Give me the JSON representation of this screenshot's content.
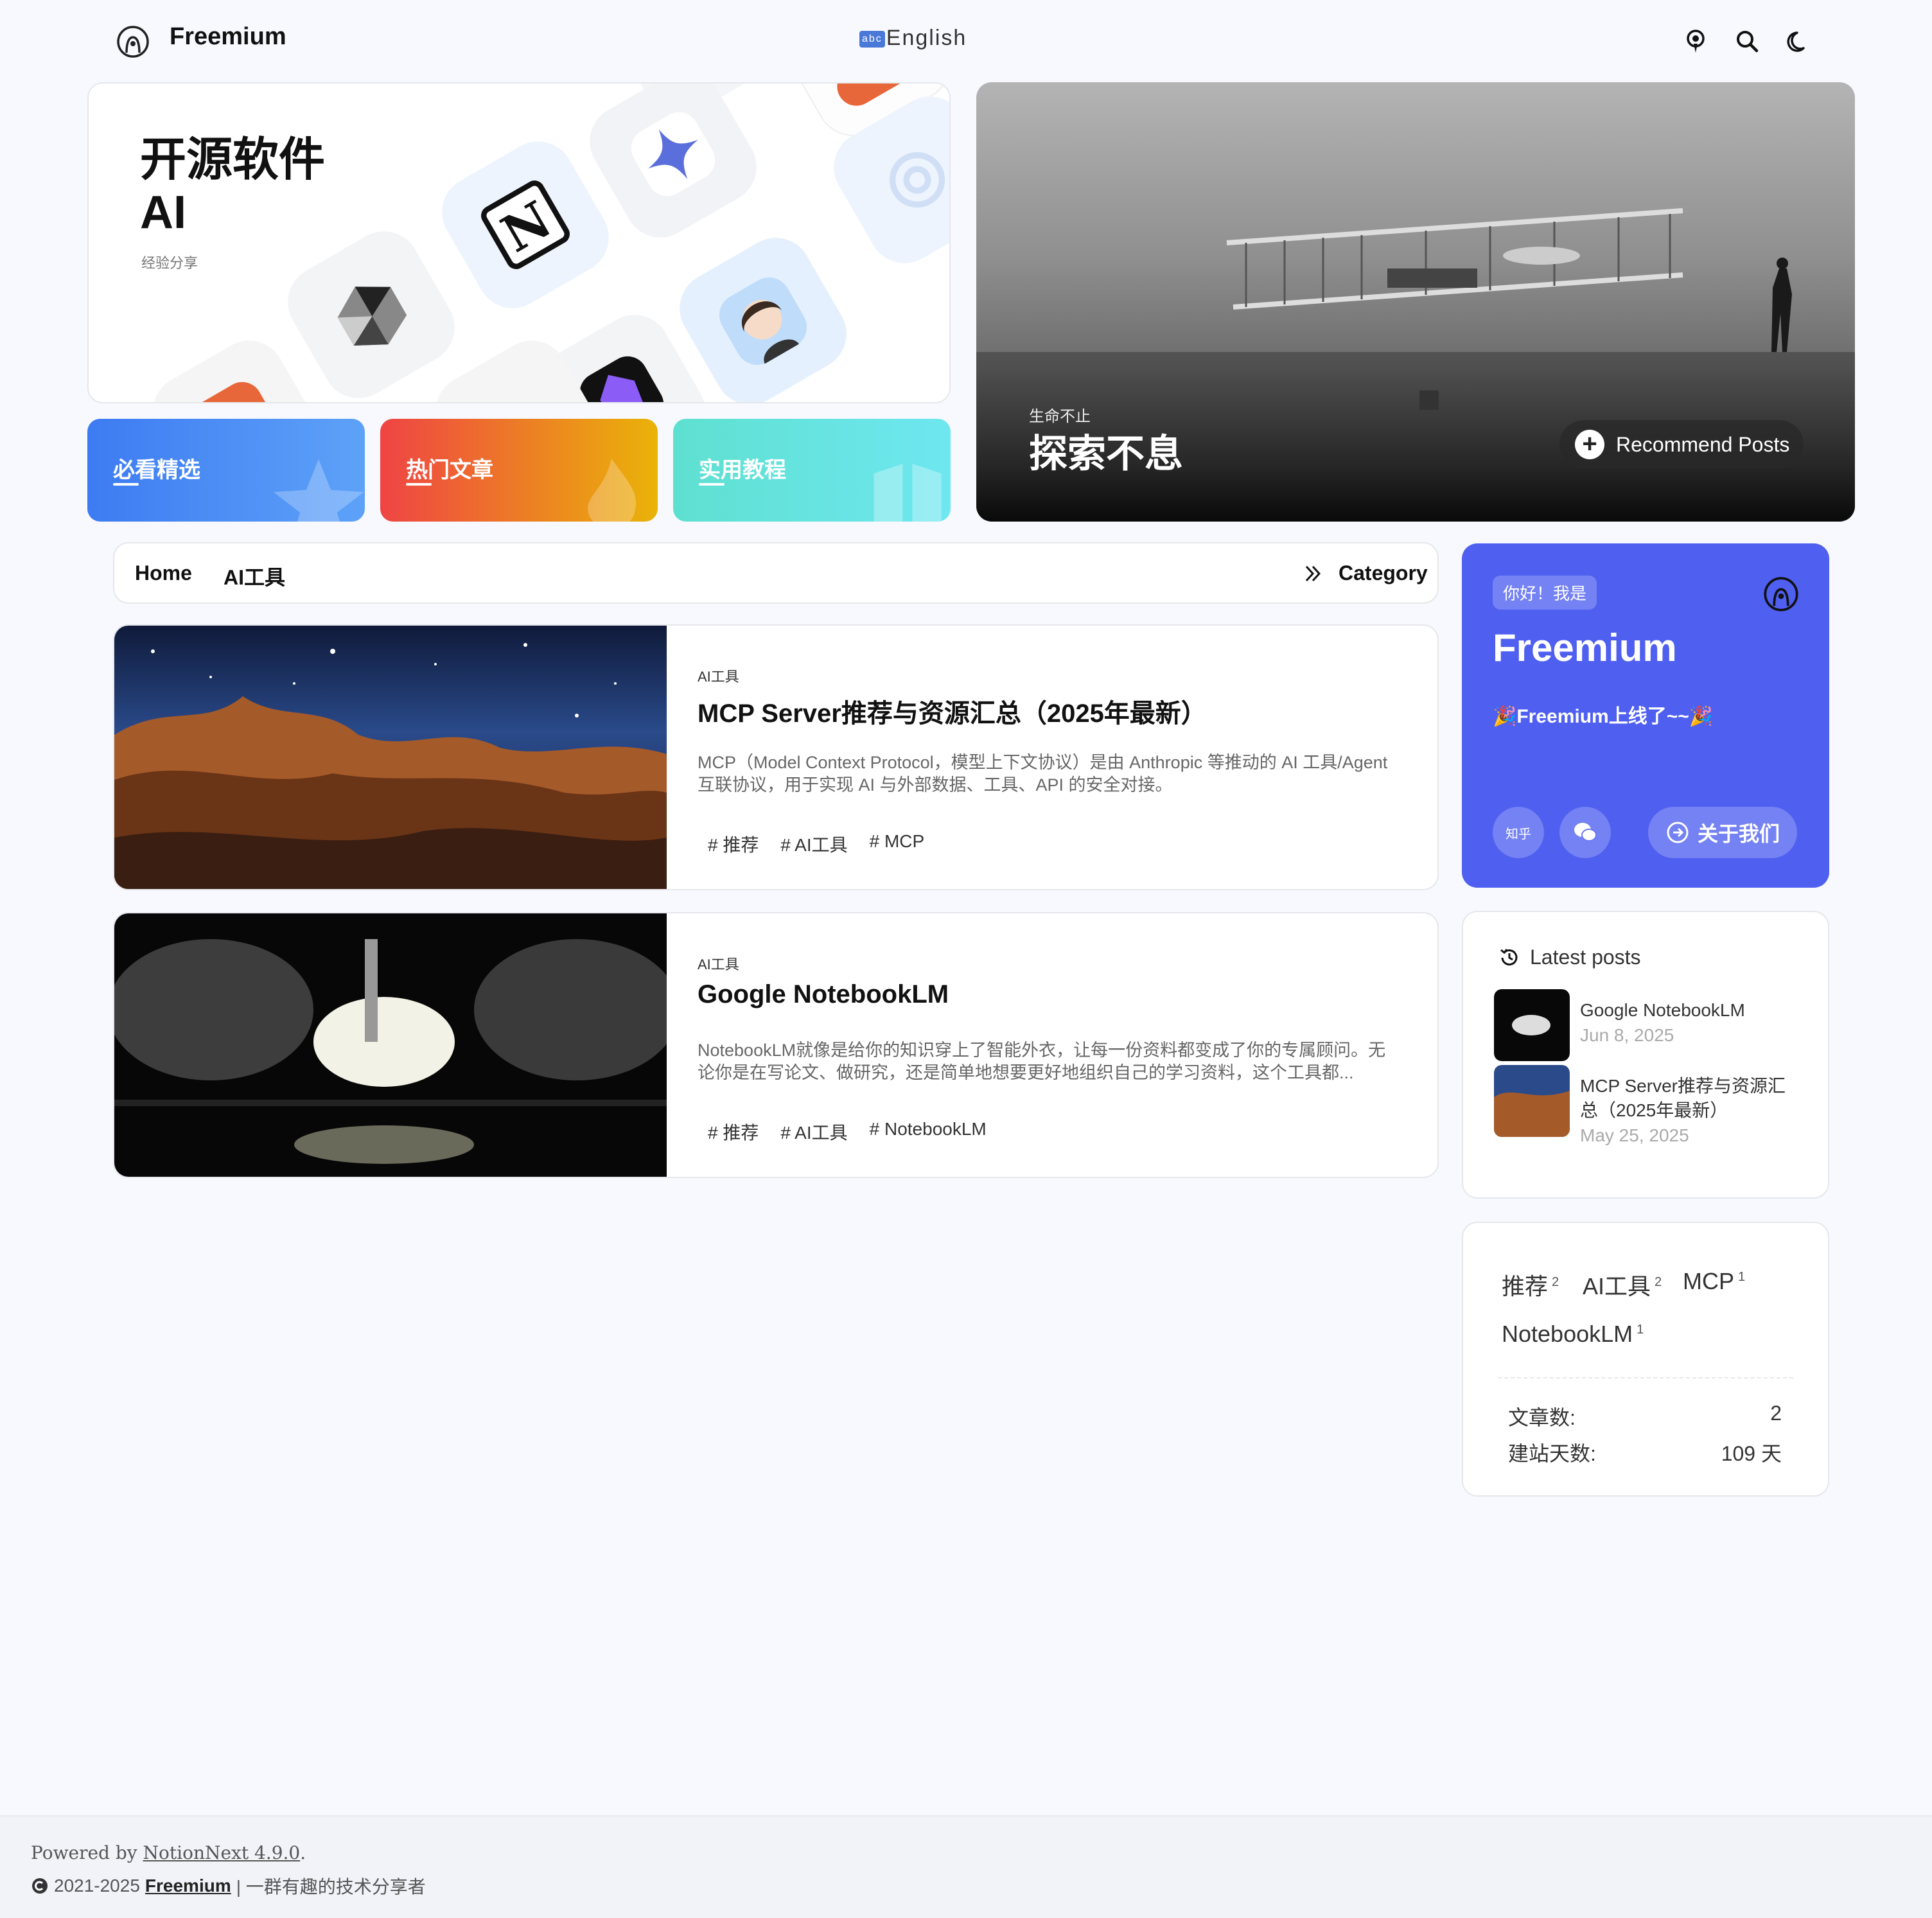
{
  "header": {
    "brand": "Freemium",
    "language": "English",
    "language_badge": "abc"
  },
  "hero": {
    "title_line1": "开源软件",
    "title_line2": "AI",
    "subtitle": "经验分享"
  },
  "categories": [
    {
      "label": "必看精选",
      "color_from": "#3d7bf2",
      "color_to": "#5da2f8"
    },
    {
      "label": "热门文章",
      "color_from": "#ef4444",
      "color_to": "#eab308"
    },
    {
      "label": "实用教程",
      "color_from": "#5ee0d0",
      "color_to": "#6ee7f0"
    }
  ],
  "feature": {
    "subtitle": "生命不止",
    "title": "探索不息",
    "button": "Recommend Posts"
  },
  "breadcrumb": {
    "home": "Home",
    "current": "AI工具",
    "category": "Category"
  },
  "posts": [
    {
      "category": "AI工具",
      "title": "MCP Server推荐与资源汇总（2025年最新）",
      "summary": "MCP（Model Context Protocol，模型上下文协议）是由 Anthropic 等推动的 AI 工具/Agent 互联协议，用于实现 AI 与外部数据、工具、API 的安全对接。",
      "tags": [
        "# 推荐",
        "# AI工具",
        "# MCP"
      ]
    },
    {
      "category": "AI工具",
      "title": "Google NotebookLM",
      "summary": "NotebookLM就像是给你的知识穿上了智能外衣，让每一份资料都变成了你的专属顾问。无论你是在写论文、做研究，还是简单地想要更好地组织自己的学习资料，这个工具都...",
      "tags": [
        "# 推荐",
        "# AI工具",
        "# NotebookLM"
      ]
    }
  ],
  "profile": {
    "greeting": "你好！我是",
    "name": "Freemium",
    "slogan": "🎉Freemium上线了~~🎉",
    "zhihu": "知乎",
    "about": "关于我们",
    "bg_color": "#4f5ff0"
  },
  "latest": {
    "heading": "Latest posts",
    "items": [
      {
        "title": "Google NotebookLM",
        "date": "Jun 8, 2025"
      },
      {
        "title": "MCP Server推荐与资源汇总（2025年最新）",
        "date": "May 25, 2025"
      }
    ]
  },
  "tag_cloud": [
    {
      "name": "推荐",
      "count": "2"
    },
    {
      "name": "AI工具",
      "count": "2"
    },
    {
      "name": "MCP",
      "count": "1"
    },
    {
      "name": "NotebookLM",
      "count": "1"
    }
  ],
  "stats": {
    "posts_label": "文章数:",
    "posts_value": "2",
    "days_label": "建站天数:",
    "days_value": "109 天"
  },
  "footer": {
    "powered_prefix": "Powered by",
    "powered_link": "NotionNext 4.9.0",
    "powered_suffix": ".",
    "years": "2021-2025",
    "site": "Freemium",
    "tagline": "| 一群有趣的技术分享者"
  }
}
